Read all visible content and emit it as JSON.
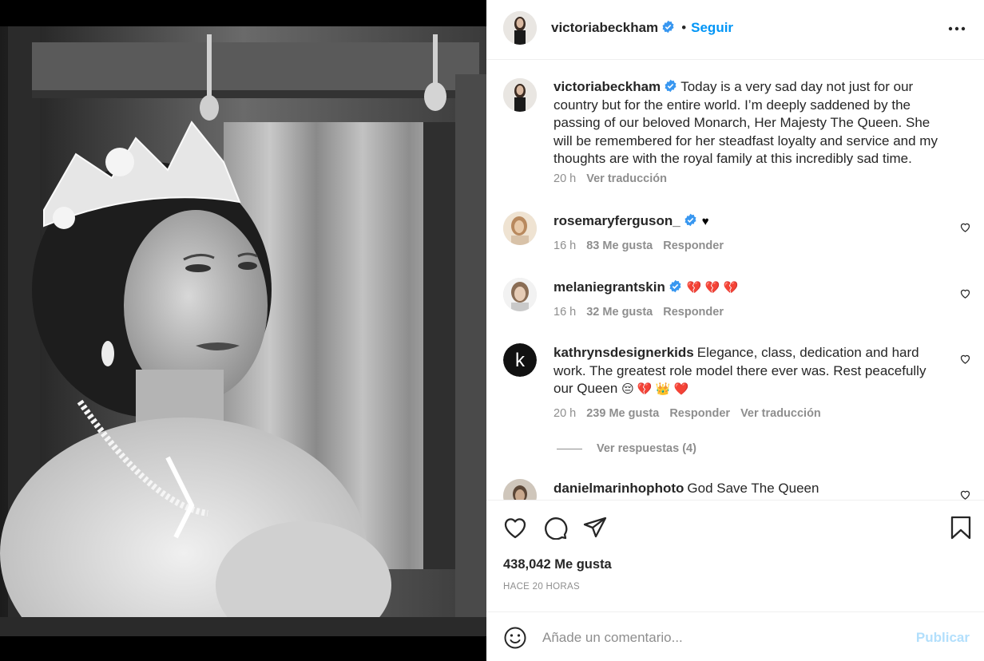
{
  "post": {
    "author": "victoriabeckham",
    "follow_label": "Seguir",
    "separator": "•",
    "caption": "Today is a very sad day not just for our country but for the entire world. I’m deeply saddened by the passing of our beloved Monarch, Her Majesty The Queen. She will be remembered for her steadfast loyalty and service and my thoughts are with the royal family at this incredibly sad time.",
    "caption_time": "20 h",
    "caption_translate": "Ver traducción",
    "likes": "438,042 Me gusta",
    "posted_ago": "HACE 20 HORAS"
  },
  "comments": [
    {
      "user": "rosemaryferguson_",
      "verified": true,
      "text": "",
      "emoji": "♥",
      "emoji_color": "#000000",
      "time": "16 h",
      "likes": "83 Me gusta",
      "reply": "Responder"
    },
    {
      "user": "melaniegrantskin",
      "verified": true,
      "text": "",
      "emoji": "💔 💔 💔",
      "emoji_color": "#e8467c",
      "time": "16 h",
      "likes": "32 Me gusta",
      "reply": "Responder"
    },
    {
      "user": "kathrynsdesignerkids",
      "verified": false,
      "text": "Elegance, class, dedication and hard work. The greatest role model there ever was. Rest peacefully our Queen",
      "emoji": "😔 💔 👑 ❤️",
      "time": "20 h",
      "likes": "239 Me gusta",
      "reply": "Responder",
      "translate": "Ver traducción",
      "view_replies": "Ver respuestas (4)"
    },
    {
      "user": "danielmarinhophoto",
      "verified": false,
      "text": "God Save The Queen"
    }
  ],
  "input": {
    "placeholder": "Añade un comentario...",
    "submit_label": "Publicar"
  },
  "icons": {
    "like": "heart-icon",
    "comment": "comment-bubble-icon",
    "share": "paper-plane-icon",
    "save": "bookmark-icon",
    "emoji": "smiley-icon",
    "more": "ellipsis-icon",
    "verified": "verified-badge-icon"
  },
  "colors": {
    "accent": "#0095f6",
    "verified": "#3897f0",
    "muted": "#8e8e8e",
    "publish_disabled": "#b2dffc"
  }
}
